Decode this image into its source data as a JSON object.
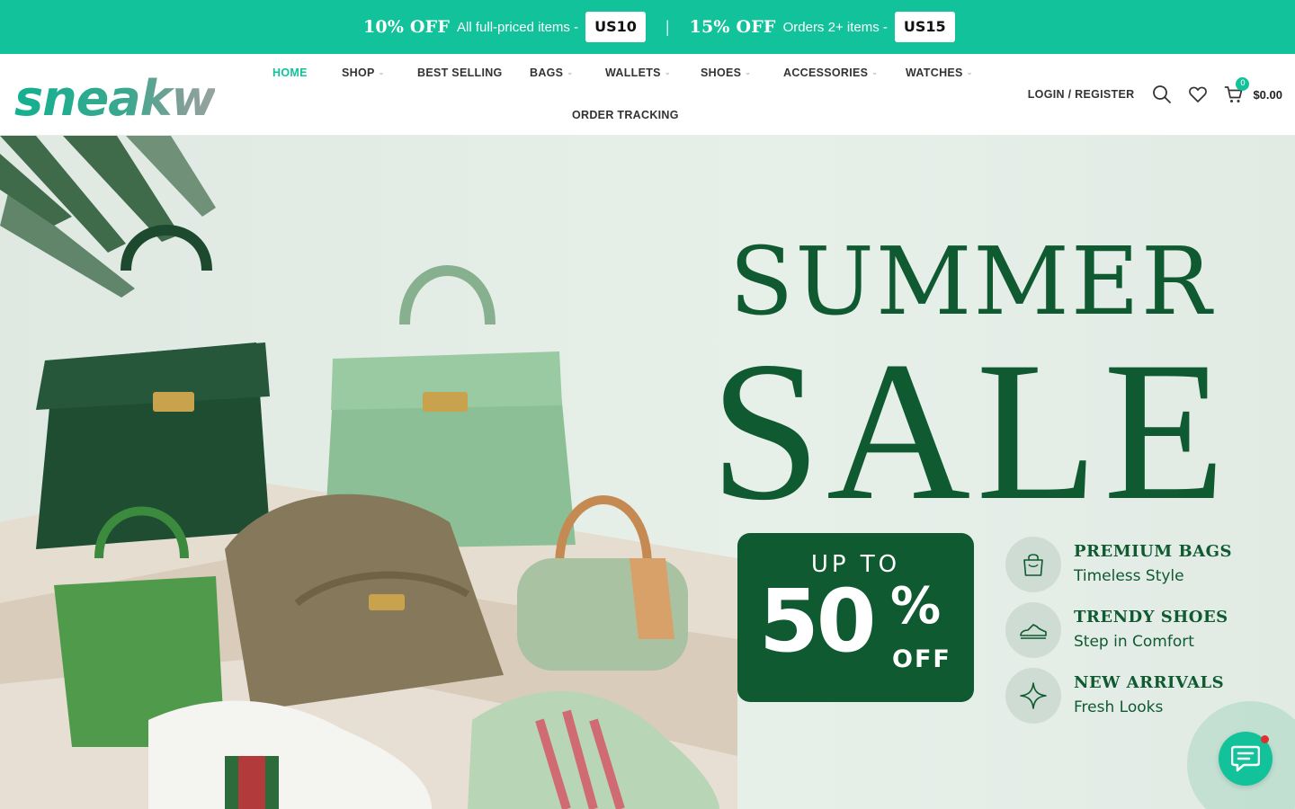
{
  "promo": {
    "offer1_big": "10% OFF",
    "offer1_text": "All full-priced items -",
    "offer1_code": "US10",
    "separator": "|",
    "offer2_big": "15% OFF",
    "offer2_text": "Orders 2+ items -",
    "offer2_code": "US15"
  },
  "header": {
    "logo_text": "sneakw",
    "nav": [
      {
        "label": "HOME",
        "dropdown": false,
        "active": true
      },
      {
        "label": "SHOP",
        "dropdown": true
      },
      {
        "label": "BEST SELLING",
        "dropdown": false
      },
      {
        "label": "BAGS",
        "dropdown": true
      },
      {
        "label": "WALLETS",
        "dropdown": true
      },
      {
        "label": "SHOES",
        "dropdown": true
      },
      {
        "label": "ACCESSORIES",
        "dropdown": true
      },
      {
        "label": "WATCHES",
        "dropdown": true
      },
      {
        "label": "ORDER TRACKING",
        "dropdown": false
      }
    ],
    "login_label": "LOGIN / REGISTER",
    "icons": [
      "search-icon",
      "heart-icon",
      "cart-icon"
    ],
    "cart_count": "0",
    "cart_total": "$0.00"
  },
  "hero": {
    "headline_top": "SUMMER",
    "headline_main": "SALE",
    "badge": {
      "up_to": "UP TO",
      "number": "50",
      "percent": "%",
      "off": "OFF"
    },
    "features": [
      {
        "icon": "shopping-bag-icon",
        "title": "PREMIUM BAGS",
        "subtitle": "Timeless Style"
      },
      {
        "icon": "sneaker-icon",
        "title": "TRENDY SHOES",
        "subtitle": "Step in Comfort"
      },
      {
        "icon": "sparkle-icon",
        "title": "NEW ARRIVALS",
        "subtitle": "Fresh Looks"
      }
    ]
  },
  "colors": {
    "accent": "#12c29a",
    "brand_green": "#0f5a30",
    "hero_bg": "#e4ede6",
    "notification": "#e03030"
  },
  "chat": {
    "icon": "chat-icon"
  }
}
